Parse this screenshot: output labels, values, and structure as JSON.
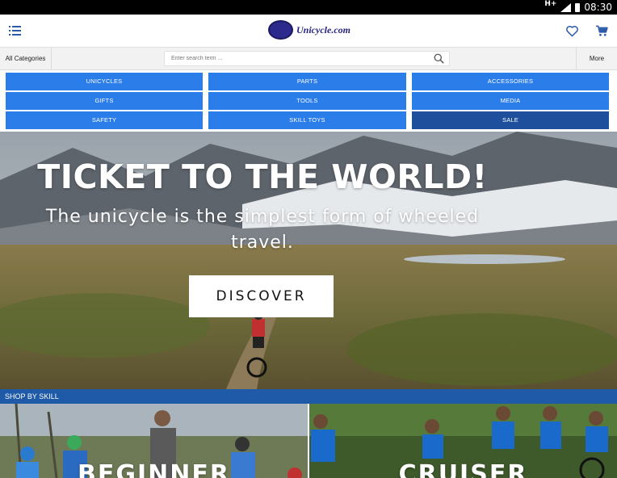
{
  "status_bar": {
    "network": "H+",
    "time": "08:30"
  },
  "header": {
    "logo_text": "Unicycle.com",
    "menu_icon": "list-menu-icon",
    "wishlist_icon": "heart-icon",
    "cart_icon": "shopping-cart-icon"
  },
  "search_row": {
    "all_categories_label": "All Categories",
    "search_placeholder": "Enter search term ...",
    "search_value": "",
    "more_label": "More"
  },
  "categories": [
    {
      "label": "UNICYCLES"
    },
    {
      "label": "PARTS"
    },
    {
      "label": "ACCESSORIES"
    },
    {
      "label": "GIFTS"
    },
    {
      "label": "TOOLS"
    },
    {
      "label": "MEDIA"
    },
    {
      "label": "SAFETY"
    },
    {
      "label": "SKILL TOYS"
    },
    {
      "label": "SALE"
    }
  ],
  "hero": {
    "title": "TICKET TO THE WORLD!",
    "subtitle": "The unicycle is the simplest form of wheeled travel.",
    "cta_label": "DISCOVER"
  },
  "shop_by_skill": {
    "heading": "SHOP BY SKILL",
    "tiles": [
      {
        "label": "BEGINNER"
      },
      {
        "label": "CRUISER"
      }
    ]
  },
  "colors": {
    "category_blue": "#2b7de9",
    "sale_blue": "#1d4f9c",
    "skill_bar_blue": "#1f5aa8",
    "header_icon_blue": "#2a5aa8"
  }
}
